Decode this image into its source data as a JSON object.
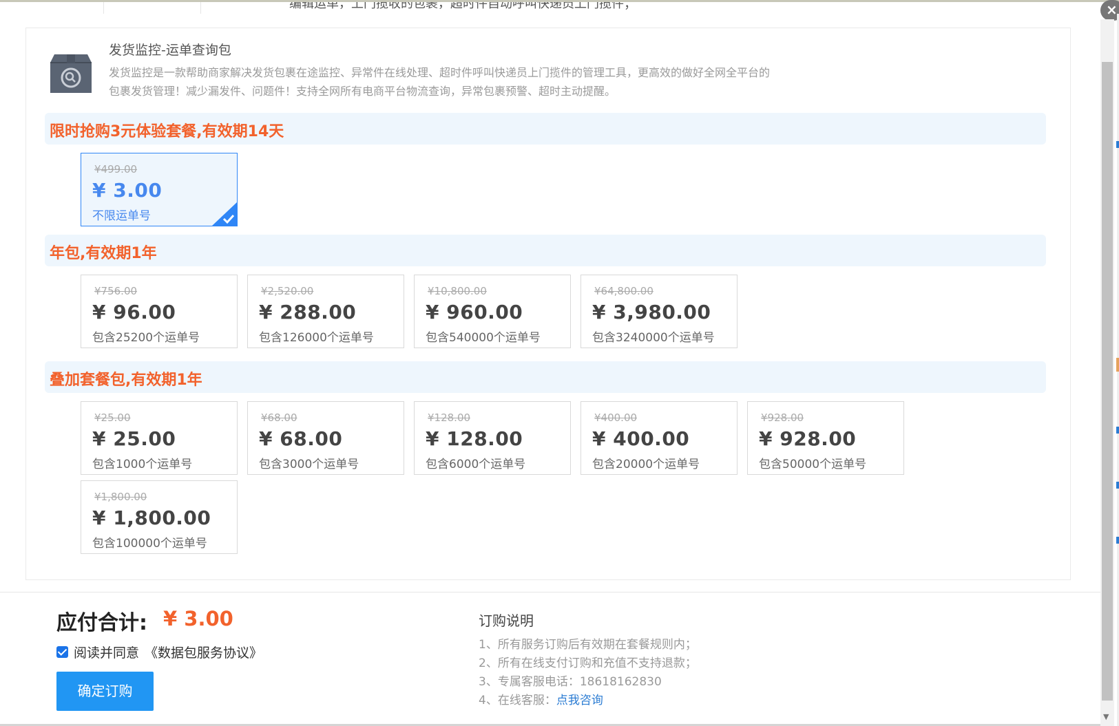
{
  "top": {
    "cut_text": "编辑运单，上门揽收的包裹，超时件自动呼叫快递员上门揽件；"
  },
  "product": {
    "title": "发货监控-运单查询包",
    "desc_line1": "发货监控是一款帮助商家解决发货包裹在途监控、异常件在线处理、超时件呼叫快递员上门揽件的管理工具，更高效的做好全网全平台的",
    "desc_line2": "包裹发货管理！减少漏发件、问题件！支持全网所有电商平台物流查询，异常包裹预警、超时主动提醒。",
    "icon": "package-search-icon"
  },
  "sections": [
    {
      "title": "限时抢购3元体验套餐,有效期14天",
      "cards": [
        {
          "orig": "¥499.00",
          "price": "¥ 3.00",
          "desc": "不限运单号"
        }
      ]
    },
    {
      "title": "年包,有效期1年",
      "cards": [
        {
          "orig": "¥756.00",
          "price": "¥ 96.00",
          "desc": "包含25200个运单号"
        },
        {
          "orig": "¥2,520.00",
          "price": "¥ 288.00",
          "desc": "包含126000个运单号"
        },
        {
          "orig": "¥10,800.00",
          "price": "¥ 960.00",
          "desc": "包含540000个运单号"
        },
        {
          "orig": "¥64,800.00",
          "price": "¥ 3,980.00",
          "desc": "包含3240000个运单号"
        }
      ]
    },
    {
      "title": "叠加套餐包,有效期1年",
      "cards": [
        {
          "orig": "¥25.00",
          "price": "¥ 25.00",
          "desc": "包含1000个运单号"
        },
        {
          "orig": "¥68.00",
          "price": "¥ 68.00",
          "desc": "包含3000个运单号"
        },
        {
          "orig": "¥128.00",
          "price": "¥ 128.00",
          "desc": "包含6000个运单号"
        },
        {
          "orig": "¥400.00",
          "price": "¥ 400.00",
          "desc": "包含20000个运单号"
        },
        {
          "orig": "¥928.00",
          "price": "¥ 928.00",
          "desc": "包含50000个运单号"
        },
        {
          "orig": "¥1,800.00",
          "price": "¥ 1,800.00",
          "desc": "包含100000个运单号"
        }
      ]
    }
  ],
  "footer": {
    "total_label": "应付合计:",
    "total_value": "¥ 3.00",
    "agree_text": "阅读并同意",
    "agreement_link": "《数据包服务协议》",
    "agree_checked": true,
    "confirm_label": "确定订购",
    "notes_title": "订购说明",
    "note_1": "1、所有服务订购后有效期在套餐规则内；",
    "note_2": "2、所有在线支付订购和充值不支持退款；",
    "note_3": "3、专属客服电话：18618162830",
    "note_4_prefix": "4、在线客服：",
    "note_4_link": "点我咨询"
  },
  "colors": {
    "accent_orange": "#f2622c",
    "accent_blue": "#2196f3",
    "selected_blue": "#4788ee"
  }
}
